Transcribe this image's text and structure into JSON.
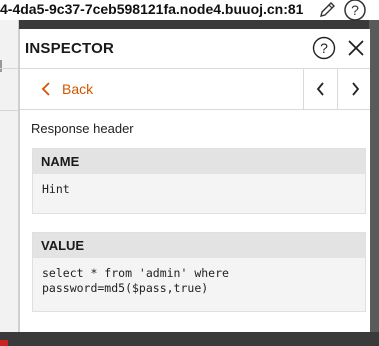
{
  "window": {
    "host_text": "4-4da5-9c37-7ceb598121fa.node4.buuoj.cn:81"
  },
  "inspector": {
    "title": "INSPECTOR",
    "back_label": "Back",
    "section_title": "Response header",
    "name_header": "NAME",
    "name_value": "Hint",
    "value_header": "VALUE",
    "value_text": "select * from 'admin' where\npassword=md5($pass,true)"
  },
  "colors": {
    "accent": "#d35400",
    "header_bg": "#e3e3e3",
    "box_bg": "#f4f4f4"
  },
  "icons": [
    "edit-icon",
    "help-icon",
    "close-icon",
    "chevron-left-icon",
    "chevron-right-icon",
    "back-arrow-icon"
  ]
}
